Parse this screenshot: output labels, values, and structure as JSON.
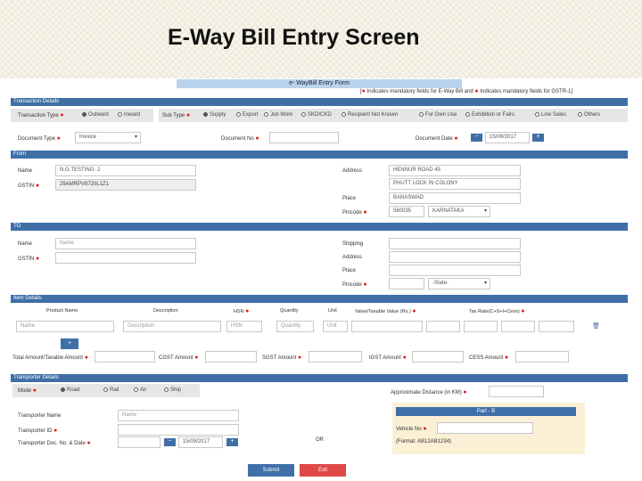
{
  "slide_title": "E-Way Bill Entry Screen",
  "form_title": "e- WayBill Entry Form",
  "legend": {
    "part1": "Indicates mandatory fields for E-Way Bill and",
    "part2": "Indicates mandatory fields for GSTR-1"
  },
  "sections": {
    "transaction": "Transaction Details",
    "from": "From",
    "to": "TO",
    "items": "Item Details",
    "transport": "Transporter Details"
  },
  "transaction": {
    "transaction_type_label": "Transaction Type",
    "transaction_types": [
      "Outward",
      "Inward"
    ],
    "sub_type_label": "Sub Type",
    "sub_types": [
      "Supply",
      "Export",
      "Job Work",
      "SKD/CKD",
      "Recipient Not Known",
      "For Own Use",
      "Exhibition or Fairs",
      "Line Sales",
      "Others"
    ],
    "document_type_label": "Document Type",
    "document_type_value": "Invoice",
    "document_no_label": "Document No",
    "document_date_label": "Document Date",
    "document_date_value": "15/09/2017"
  },
  "from": {
    "name_label": "Name",
    "name_value": "N.G.TESTING- 2",
    "gstin_label": "GSTIN",
    "gstin_value": "29AMRPV8720L1Z1",
    "address_label": "Address",
    "address_line1": "HENNUR ROAD 45",
    "address_line2": "PHUTT LOCK IN COLONY",
    "place_label": "Place",
    "place_value": "BANASWAD",
    "pincode_label": "Pincode",
    "pincode_value": "560035",
    "state_value": "KARNATAKA"
  },
  "to": {
    "name_label": "Name",
    "name_placeholder": "Name",
    "gstin_label": "GSTIN",
    "shipping_label": "Shipping",
    "address_label": "Address",
    "place_label": "Place",
    "pincode_label": "Pincode",
    "state_value": "-State-"
  },
  "items": {
    "headers": [
      "Product Name",
      "Description",
      "HSN",
      "Quantity",
      "Unit",
      "Value/Taxable Value (Rs.)",
      "Tax Rate(C+S+I+Cess)"
    ],
    "placeholders": {
      "name": "Name",
      "description": "Description",
      "hsn": "HSN",
      "quantity": "Quantity",
      "unit": "Unit"
    },
    "add_label": "+",
    "total_label": "Total Amount/Taxable Amount",
    "cgst_label": "CGST Amount",
    "sgst_label": "SGST Amount",
    "igst_label": "IGST Amount",
    "cess_label": "CESS Amount"
  },
  "transport": {
    "mode_label": "Mode",
    "modes": [
      "Road",
      "Rail",
      "Air",
      "Ship"
    ],
    "distance_label": "Approximate Distance (in KM)",
    "transporter_name_label": "Transporter Name",
    "transporter_name_placeholder": "Name",
    "transporter_id_label": "Transporter ID",
    "doc_label": "Transporter Doc. No. & Date",
    "doc_date": "15/09/2017",
    "or_label": "OR",
    "part_b_title": "Part - B",
    "vehicle_label": "Vehicle No",
    "vehicle_hint": "(Format: AB12AB1234)"
  },
  "buttons": {
    "submit": "Submit",
    "exit": "Exit"
  },
  "colors": {
    "section_bar": "#3f6fa7",
    "mandatory": "#e02020",
    "submit": "#3f6fa7",
    "exit": "#e04848",
    "part_b_bg": "#fbf0d6"
  }
}
